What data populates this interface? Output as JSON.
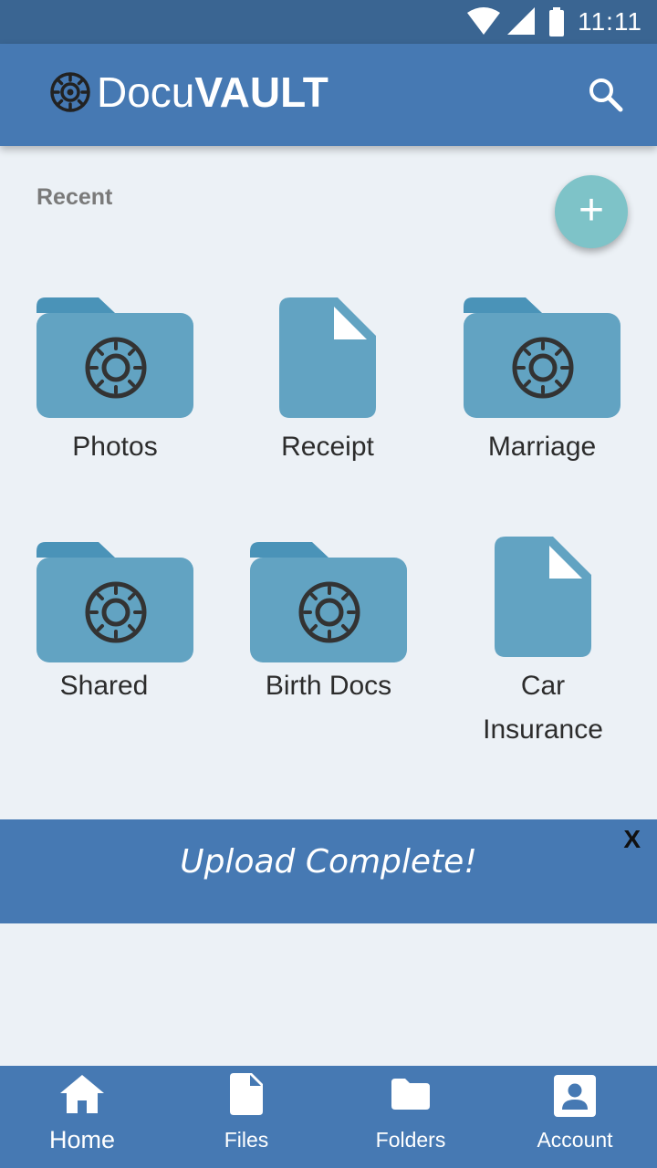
{
  "status_bar": {
    "time": "11:11"
  },
  "app_bar": {
    "logo_light": "Docu",
    "logo_bold": "VAULT"
  },
  "recent": {
    "title": "Recent",
    "items": [
      {
        "label": "Photos",
        "type": "folder"
      },
      {
        "label": "Receipt",
        "type": "file"
      },
      {
        "label": "Marriage",
        "type": "folder"
      },
      {
        "label": "Shared",
        "type": "folder"
      },
      {
        "label": "Birth Docs",
        "type": "folder"
      },
      {
        "label_line1": "Car",
        "label_line2": "Insurance",
        "type": "file"
      }
    ]
  },
  "fab": {
    "symbol": "+"
  },
  "toast": {
    "message": "Upload Complete!",
    "close": "X"
  },
  "bottom_nav": {
    "items": [
      {
        "label": "Home",
        "icon": "home-icon"
      },
      {
        "label": "Files",
        "icon": "file-icon"
      },
      {
        "label": "Folders",
        "icon": "folder-icon"
      },
      {
        "label": "Account",
        "icon": "account-icon"
      }
    ]
  },
  "colors": {
    "primary": "#4679B3",
    "status_bar": "#3A6592",
    "tile": "#62A3C2",
    "tile_dark": "#4A93B8",
    "fab": "#7EC3C8",
    "background": "#ECF1F6"
  }
}
